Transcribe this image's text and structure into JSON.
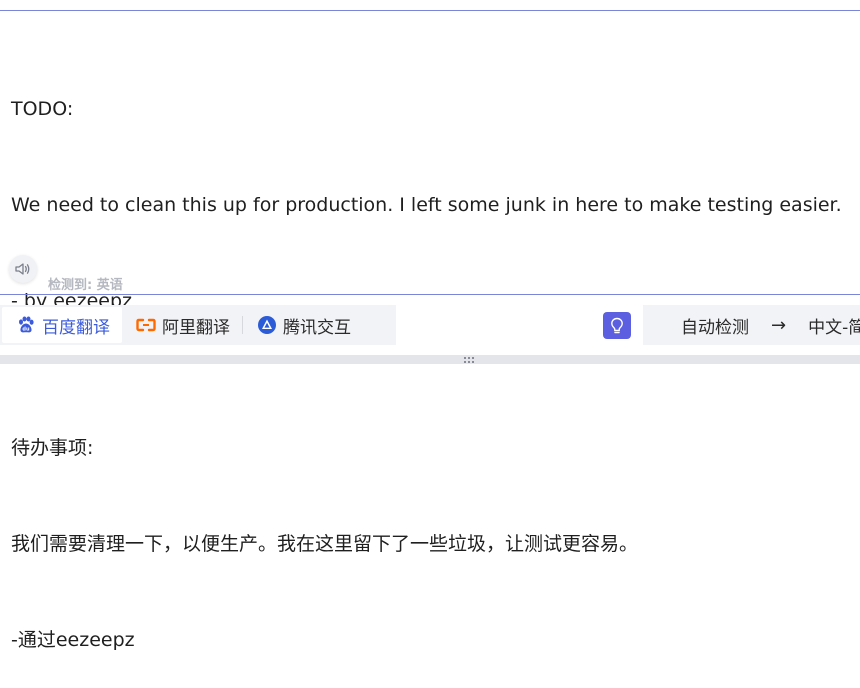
{
  "source": {
    "text_lines": [
      "TODO:",
      "We need to clean this up for production. I left some junk in here to make testing easier.",
      "- by eezeepz"
    ],
    "detected_label": "检测到: 英语"
  },
  "engines": [
    {
      "label": "百度翻译",
      "icon": "baidu-paw-icon",
      "active": true
    },
    {
      "label": "阿里翻译",
      "icon": "alibaba-icon",
      "active": false
    },
    {
      "label": "腾讯交互",
      "icon": "tencent-icon",
      "active": false
    }
  ],
  "language": {
    "from": "自动检测",
    "arrow": "→",
    "to": "中文-简"
  },
  "result": {
    "text_lines": [
      "待办事项:",
      "我们需要清理一下，以便生产。我在这里留下了一些垃圾，让测试更容易。",
      "-通过eezeepz"
    ]
  },
  "colors": {
    "accent": "#3b5bdb",
    "bulb": "#5b5fe0",
    "alibaba": "#ff6a00",
    "tencent": "#2b5bd7"
  }
}
